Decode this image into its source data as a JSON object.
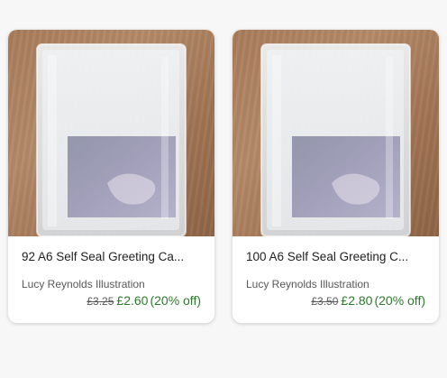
{
  "listings": [
    {
      "title": "92 A6 Self Seal Greeting Ca...",
      "shop": "Lucy Reynolds Illustration",
      "original_price": "£3.25",
      "sale_price": "£2.60",
      "discount": "(20% off)",
      "image_icon": "product-photo"
    },
    {
      "title": "100 A6 Self Seal Greeting C...",
      "shop": "Lucy Reynolds Illustration",
      "original_price": "£3.50",
      "sale_price": "£2.80",
      "discount": "(20% off)",
      "image_icon": "product-photo"
    }
  ],
  "colors": {
    "sale_price": "#2c7a2c",
    "muted_text": "#595959",
    "title_text": "#222222",
    "table_wood": "#a87c5c"
  }
}
